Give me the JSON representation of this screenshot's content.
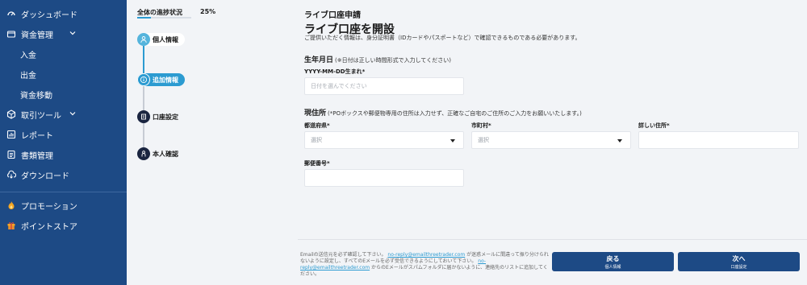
{
  "colors": {
    "sidebar_bg": "#1d4a85",
    "accent": "#2c9bd1",
    "button": "#1d4a85",
    "page_bg": "#f2f4f7"
  },
  "sidebar": {
    "items": [
      {
        "label": "ダッシュボード",
        "icon": "dashboard-icon"
      },
      {
        "label": "資金管理",
        "icon": "wallet-icon",
        "expanded": true
      },
      {
        "label": "入金"
      },
      {
        "label": "出金"
      },
      {
        "label": "資金移動"
      },
      {
        "label": "取引ツール",
        "icon": "tools-icon",
        "expanded": true
      },
      {
        "label": "レポート",
        "icon": "report-icon"
      },
      {
        "label": "書類管理",
        "icon": "document-icon"
      },
      {
        "label": "ダウンロード",
        "icon": "cloud-download-icon"
      },
      {
        "label": "プロモーション",
        "icon": "fire-icon"
      },
      {
        "label": "ポイントストア",
        "icon": "gift-icon"
      }
    ]
  },
  "progress": {
    "label": "全体の進捗状況",
    "percent_text": "25%",
    "percent": 25
  },
  "steps": [
    {
      "label": "個人情報",
      "icon": "user-icon",
      "state": "done"
    },
    {
      "label": "追加情報",
      "icon": "info-icon",
      "state": "active"
    },
    {
      "label": "口座設定",
      "icon": "account-icon",
      "state": "todo"
    },
    {
      "label": "本人確認",
      "icon": "id-icon",
      "state": "todo"
    }
  ],
  "form": {
    "header_small": "ライブ口座申請",
    "header_big": "ライブ口座を開設",
    "description": "ご提供いただく情報は、身分証明書（IDカードやパスポートなど）で確認できるものである必要があります。",
    "birth": {
      "section_title": "生年月日",
      "section_note": "(※日付は正しい時間形式で入力してください)",
      "label": "YYYY-MM-DD生まれ*",
      "placeholder": "日付を選んでください"
    },
    "address": {
      "section_title": "現住所",
      "section_note": "(*POボックスや郵便物専用の住所は入力せず、正確なご自宅のご住所のご入力をお願いいたします。)",
      "prefecture_label": "都道府県*",
      "prefecture_value": "選択",
      "city_label": "市町村*",
      "city_value": "選択",
      "detail_label": "詳しい住所*",
      "postal_label": "郵便番号*"
    }
  },
  "footer": {
    "text_1": "Emailの送信元を必ず確認して下さい。",
    "link_1": "no-reply@emailthreetrader.com",
    "text_2": "が迷惑メールに間違って振り分けられないように設定し、すべてのEメールを必ず受信できるようにしておいて下さい。",
    "link_2": "no-reply@emailthreetrader.com",
    "text_3": "からのEメールがスパムフォルダに届かないように、連絡先のリストに追加してください。"
  },
  "buttons": {
    "back": {
      "label": "戻る",
      "sub": "個人情報"
    },
    "next": {
      "label": "次へ",
      "sub": "口座設定"
    }
  }
}
